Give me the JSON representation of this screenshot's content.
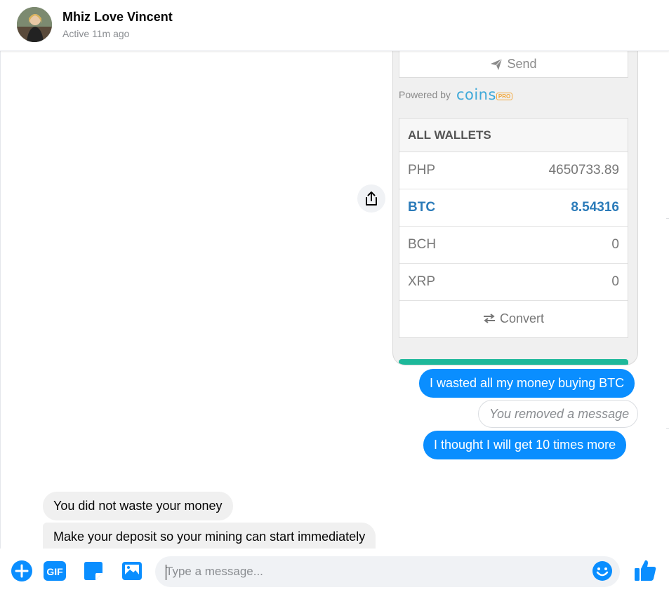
{
  "header": {
    "contact_name": "Mhiz Love Vincent",
    "status": "Active 11m ago"
  },
  "shared_image": {
    "send_label": "Send",
    "powered_by": "Powered by",
    "brand": "coins",
    "brand_badge": "PRO",
    "wallets_title": "ALL WALLETS",
    "wallets": [
      {
        "currency": "PHP",
        "amount": "4650733.89"
      },
      {
        "currency": "BTC",
        "amount": "8.54316"
      },
      {
        "currency": "BCH",
        "amount": "0"
      },
      {
        "currency": "XRP",
        "amount": "0"
      }
    ],
    "convert_label": "Convert"
  },
  "messages": [
    {
      "direction": "out",
      "text": "I wasted all my money buying BTC"
    },
    {
      "direction": "removed",
      "text": "You removed a message"
    },
    {
      "direction": "out",
      "text": "I thought I will get 10 times more"
    },
    {
      "direction": "in",
      "text": "You did not waste your money"
    },
    {
      "direction": "in",
      "text": "Make your deposit so your mining can start immediately"
    }
  ],
  "composer": {
    "placeholder": "Type a message...",
    "gif_label": "GIF"
  },
  "colors": {
    "accent": "#0a8eff",
    "btc_highlight": "#2b7bb9",
    "teal": "#1db89a",
    "coins_brand": "#3fa9d9"
  }
}
